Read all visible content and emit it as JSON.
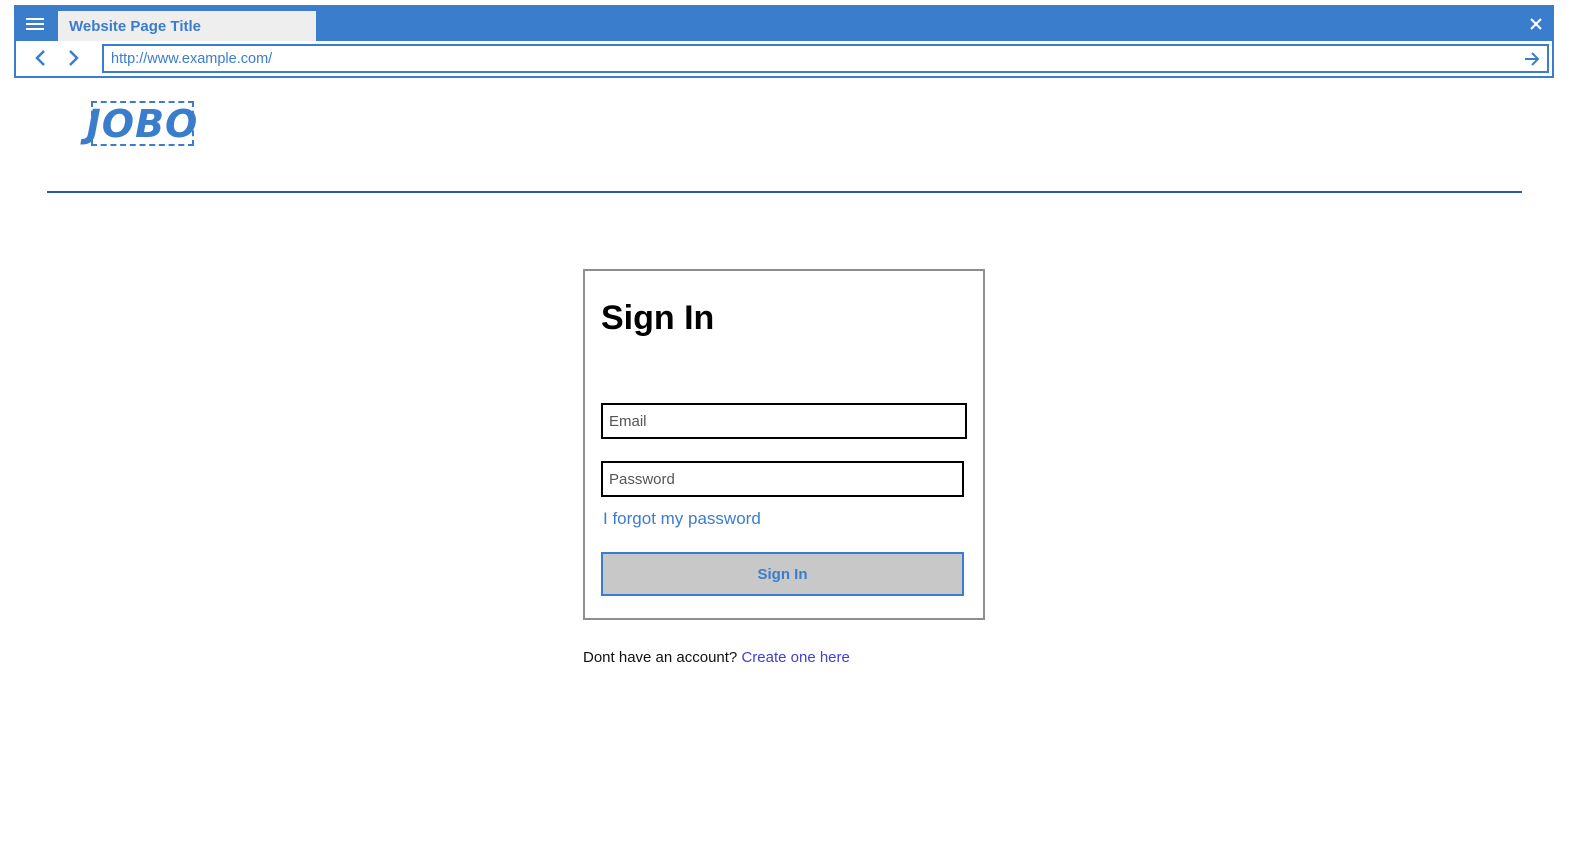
{
  "browser": {
    "tab_title": "Website Page Title",
    "url": "http://www.example.com/",
    "accent_color": "#3a7dcc",
    "icons": {
      "menu": "hamburger-menu-icon",
      "close": "close-icon",
      "back": "chevron-left-icon",
      "forward": "chevron-right-icon",
      "go": "arrow-right-icon"
    }
  },
  "header": {
    "logo_text": "JOBO"
  },
  "signin": {
    "title": "Sign In",
    "email_placeholder": "Email",
    "password_placeholder": "Password",
    "forgot_label": "I forgot my password",
    "submit_label": "Sign In"
  },
  "signup": {
    "prompt": "Dont have an account?",
    "link_label": "Create one here"
  }
}
